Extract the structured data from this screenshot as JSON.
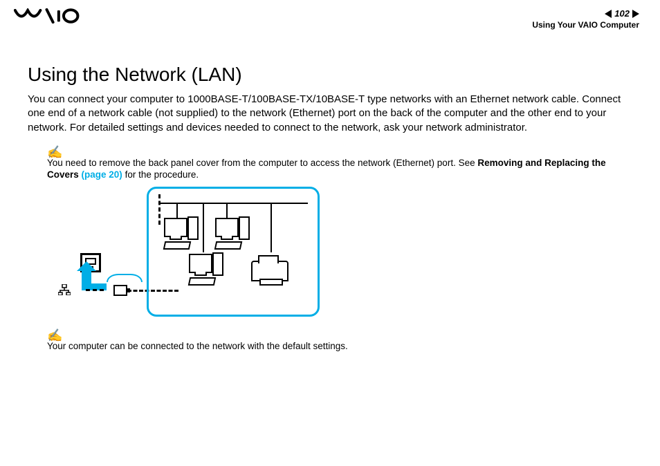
{
  "header": {
    "page_number": "102",
    "section": "Using Your VAIO Computer"
  },
  "title": "Using the Network (LAN)",
  "paragraph": "You can connect your computer to 1000BASE-T/100BASE-TX/10BASE-T type networks with an Ethernet network cable. Connect one end of a network cable (not supplied) to the network (Ethernet) port on the back of the computer and the other end to your network. For detailed settings and devices needed to connect to the network, ask your network administrator.",
  "notes": {
    "note1_pre": "You need to remove the back panel cover from the computer to access the network (Ethernet) port. See ",
    "note1_bold": "Removing and Replacing the Covers ",
    "note1_link": "(page 20)",
    "note1_post": " for the procedure.",
    "note2": "Your computer can be connected to the network with the default settings."
  }
}
